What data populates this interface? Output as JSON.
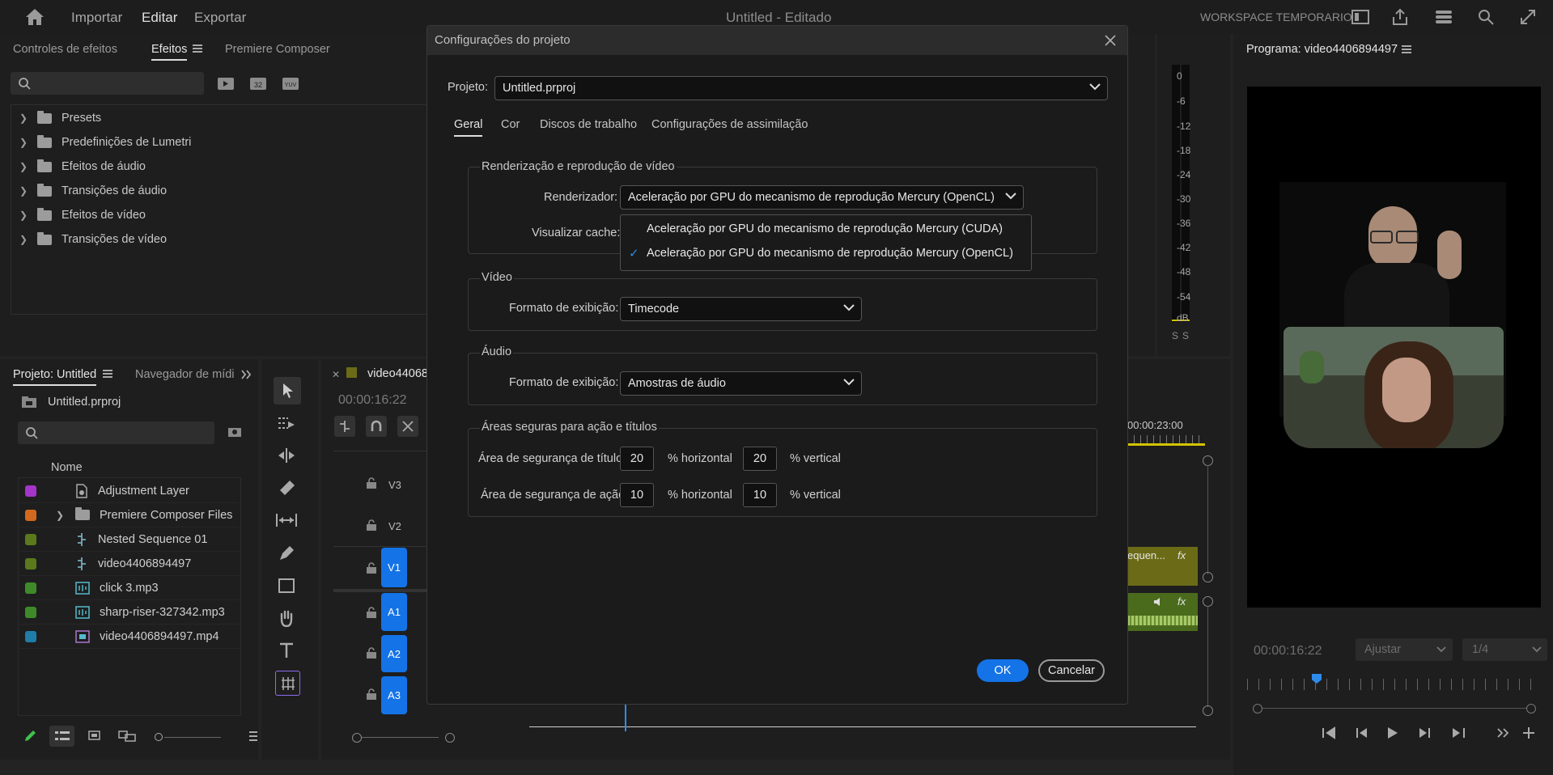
{
  "topbar": {
    "menu": [
      "Importar",
      "Editar",
      "Exportar"
    ],
    "title": "Untitled - Editado",
    "workspace": "WORKSPACE TEMPORARIO"
  },
  "effects_panel": {
    "tabs": [
      "Controles de efeitos",
      "Efeitos",
      "Premiere Composer"
    ],
    "items": [
      "Presets",
      "Predefinições de Lumetri",
      "Efeitos de áudio",
      "Transições de áudio",
      "Efeitos de vídeo",
      "Transições de vídeo"
    ],
    "icon_32": "32",
    "icon_yuv": "YUV"
  },
  "project_panel": {
    "tabs": [
      "Projeto: Untitled",
      "Navegador de mídia"
    ],
    "file": "Untitled.prproj",
    "column": "Nome",
    "items": [
      {
        "name": "Adjustment Layer",
        "color": "#a335c9"
      },
      {
        "name": "Premiere Composer Files",
        "color": "#d2691e"
      },
      {
        "name": "Nested Sequence 01",
        "color": "#5b7a1c"
      },
      {
        "name": "video4406894497",
        "color": "#5b7a1c"
      },
      {
        "name": "click 3.mp3",
        "color": "#3e8a2a"
      },
      {
        "name": "sharp-riser-327342.mp3",
        "color": "#3e8a2a"
      },
      {
        "name": "video4406894497.mp4",
        "color": "#1f7ea8"
      }
    ]
  },
  "timeline": {
    "tab": "video44068",
    "timecode": "00:00:16:22",
    "ruler_time": "00:00:23:00",
    "tracks": [
      "V3",
      "V2",
      "V1",
      "A1",
      "A2",
      "A3"
    ],
    "clip_label": "equen...",
    "fx": "fx"
  },
  "program_monitor": {
    "title": "Programa: video4406894497",
    "timecode": "00:00:16:22",
    "fit": "Ajustar",
    "resolution": "1/4"
  },
  "audio_meter": {
    "labels": [
      "0",
      "-6",
      "-12",
      "-18",
      "-24",
      "-30",
      "-36",
      "-42",
      "-48",
      "-54",
      "dB"
    ],
    "solo": [
      "S",
      "S"
    ]
  },
  "dialog": {
    "title": "Configurações do projeto",
    "project_label": "Projeto:",
    "project_value": "Untitled.prproj",
    "tabs": [
      "Geral",
      "Cor",
      "Discos de trabalho",
      "Configurações de assimilação"
    ],
    "active_tab": "Geral",
    "render_group": "Renderização e reprodução de vídeo",
    "renderer_label": "Renderizador:",
    "renderer_value": "Aceleração por GPU do mecanismo de reprodução Mercury (OpenCL)",
    "cache_label": "Visualizar cache:",
    "renderer_options": [
      "Aceleração por GPU do mecanismo de reprodução Mercury (CUDA)",
      "Aceleração por GPU do mecanismo de reprodução Mercury (OpenCL)"
    ],
    "video_group": "Vídeo",
    "video_format_label": "Formato de exibição:",
    "video_format_value": "Timecode",
    "audio_group": "Áudio",
    "audio_format_label": "Formato de exibição:",
    "audio_format_value": "Amostras de áudio",
    "safe_group": "Áreas seguras para ação e títulos",
    "title_safe_label": "Área de segurança de título",
    "title_safe_h": "20",
    "title_safe_v": "20",
    "action_safe_label": "Área de segurança de ação",
    "action_safe_h": "10",
    "action_safe_v": "10",
    "horizontal": "% horizontal",
    "vertical": "% vertical",
    "ok": "OK",
    "cancel": "Cancelar"
  },
  "colors": {
    "accent": "#1473e6",
    "clip": "#6b6b17",
    "playhead": "#2d8ceb"
  }
}
